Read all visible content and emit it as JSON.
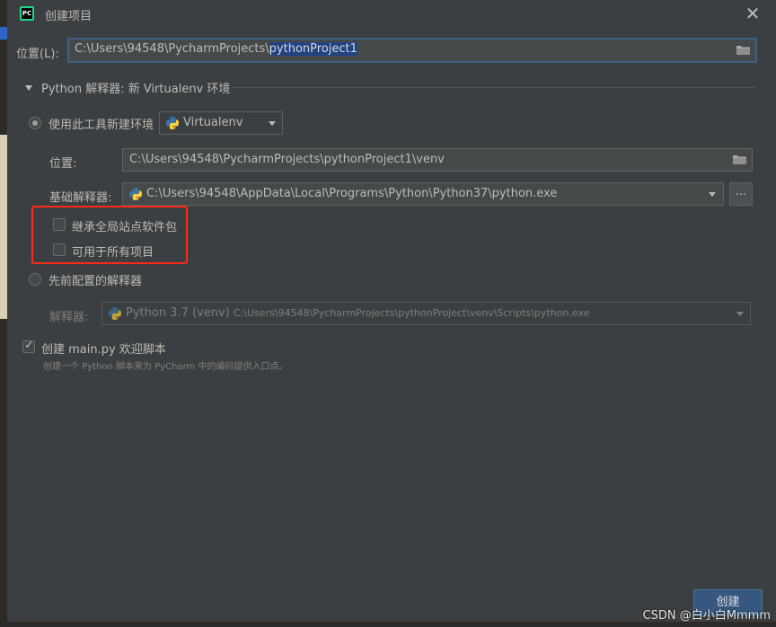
{
  "window": {
    "title": "创建项目",
    "close_glyph": "✕",
    "app_icon_text": "PC"
  },
  "location": {
    "label": "位置(L):",
    "path_prefix": "C:\\Users\\94548\\PycharmProjects\\",
    "path_selected": "pythonProject1"
  },
  "interpreter_section": {
    "title": "Python 解释器: 新 Virtualenv 环境",
    "expanded": true
  },
  "new_env": {
    "radio_label": "使用此工具新建环境",
    "selected": true,
    "tool_value": "Virtualenv",
    "location_label": "位置:",
    "location_value": "C:\\Users\\94548\\PycharmProjects\\pythonProject1\\venv",
    "base_label": "基础解释器:",
    "base_value": "C:\\Users\\94548\\AppData\\Local\\Programs\\Python\\Python37\\python.exe",
    "browse_label": "...",
    "inherit_label": "继承全局站点软件包",
    "inherit_checked": false,
    "available_label": "可用于所有项目",
    "available_checked": false
  },
  "existing": {
    "radio_label": "先前配置的解释器",
    "selected": false,
    "interp_label": "解释器:",
    "interp_name": "Python 3.7 (venv)",
    "interp_path": "C:\\Users\\94548\\PycharmProjects\\pythonProject\\venv\\Scripts\\python.exe"
  },
  "welcome": {
    "label": "创建 main.py 欢迎脚本",
    "checked": true,
    "hint": "创建一个 Python 脚本来为 PyCharm 中的编码提供入口点。"
  },
  "footer": {
    "create_label": "创建",
    "watermark": "CSDN @白小白Mmmm"
  },
  "colors": {
    "background": "#3c3f41",
    "selection": "#214283",
    "accent": "#365880",
    "highlight_box": "#ff2b1a"
  }
}
